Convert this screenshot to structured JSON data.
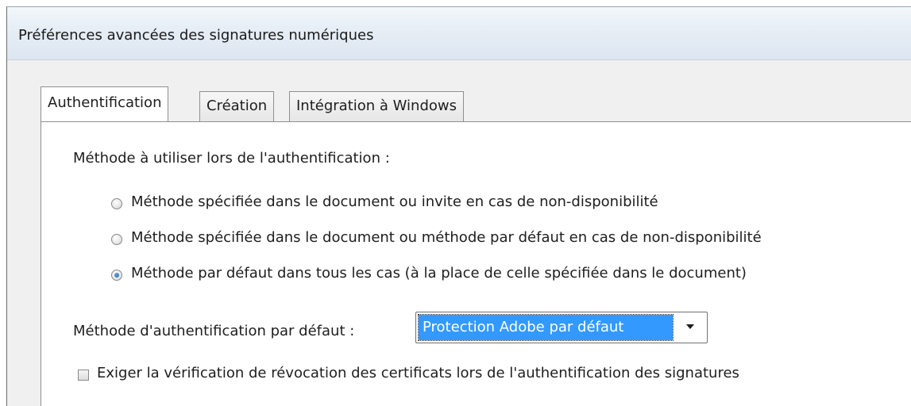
{
  "window": {
    "title": "Préférences avancées des signatures numériques"
  },
  "tabs": [
    {
      "label": "Authentification",
      "selected": true
    },
    {
      "label": "Création",
      "selected": false
    },
    {
      "label": "Intégration à Windows",
      "selected": false
    }
  ],
  "authentication": {
    "method_heading": "Méthode à utiliser lors de l'authentification :",
    "options": [
      {
        "label": "Méthode spécifiée dans le document ou invite en cas de non-disponibilité",
        "selected": false
      },
      {
        "label": "Méthode spécifiée dans le document ou méthode par défaut en cas de non-disponibilité",
        "selected": false
      },
      {
        "label": "Méthode par défaut dans tous les cas (à la place de celle spécifiée dans le document)",
        "selected": true
      }
    ],
    "default_method_label": "Méthode d'authentification par défaut :",
    "default_method_value": "Protection Adobe par défaut",
    "revocation_check_label": "Exiger la vérification de révocation des certificats lors de l'authentification des signatures",
    "revocation_check_checked": false
  },
  "colors": {
    "selection": "#3399ff",
    "panel": "#ffffff",
    "chrome": "#f0f0f0"
  }
}
